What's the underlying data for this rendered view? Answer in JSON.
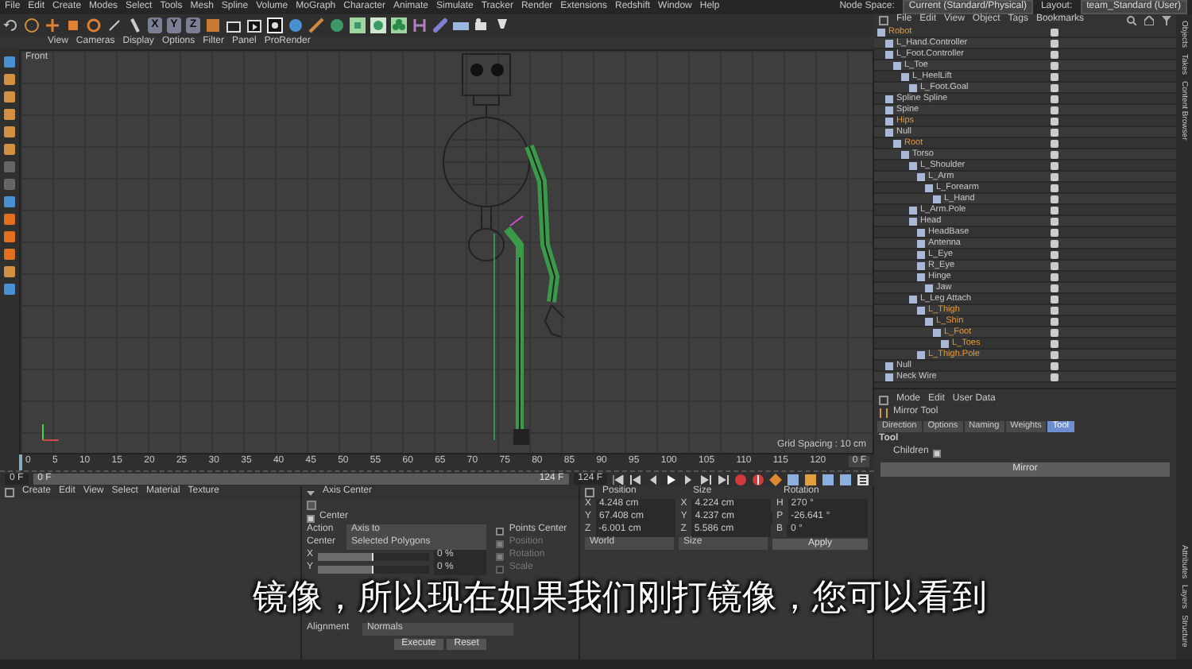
{
  "menu": [
    "File",
    "Edit",
    "Create",
    "Modes",
    "Select",
    "Tools",
    "Mesh",
    "Spline",
    "Volume",
    "MoGraph",
    "Character",
    "Animate",
    "Simulate",
    "Tracker",
    "Render",
    "Extensions",
    "Redshift",
    "Window",
    "Help"
  ],
  "node_space": {
    "label": "Node Space:",
    "value": "Current (Standard/Physical)"
  },
  "layout": {
    "label": "Layout:",
    "value": "team_Standard (User)"
  },
  "axis_buttons": [
    "X",
    "Y",
    "Z"
  ],
  "viewport": {
    "menu": [
      "View",
      "Cameras",
      "Display",
      "Options",
      "Filter",
      "Panel",
      "ProRender"
    ],
    "view_name": "Front",
    "grid_spacing": "Grid Spacing : 10 cm"
  },
  "timeline": {
    "ticks": [
      "0",
      "5",
      "10",
      "15",
      "20",
      "25",
      "30",
      "35",
      "40",
      "45",
      "50",
      "55",
      "60",
      "65",
      "70",
      "75",
      "80",
      "85",
      "90",
      "95",
      "100",
      "105",
      "110",
      "115",
      "120"
    ],
    "current_frame": "0 F",
    "start_field": "0 F",
    "range_start": "0 F",
    "range_end": "124 F",
    "end_field": "124 F"
  },
  "object_manager": {
    "menu": [
      "File",
      "Edit",
      "View",
      "Object",
      "Tags",
      "Bookmarks"
    ],
    "objects": [
      {
        "name": "Robot",
        "selected": true,
        "children": [
          {
            "name": "L_Hand.Controller",
            "selected": false
          },
          {
            "name": "L_Foot.Controller",
            "selected": false,
            "children": [
              {
                "name": "L_Toe",
                "selected": false,
                "children": [
                  {
                    "name": "L_HeelLift",
                    "selected": false,
                    "children": [
                      {
                        "name": "L_Foot.Goal",
                        "selected": false
                      }
                    ]
                  }
                ]
              }
            ]
          },
          {
            "name": "Spline Spline",
            "selected": false
          },
          {
            "name": "Spine",
            "selected": false
          },
          {
            "name": "Hips",
            "selected": true
          },
          {
            "name": "Null",
            "selected": false,
            "children": [
              {
                "name": "Root",
                "selected": true,
                "children": [
                  {
                    "name": "Torso",
                    "selected": false,
                    "children": [
                      {
                        "name": "L_Shoulder",
                        "selected": false,
                        "children": [
                          {
                            "name": "L_Arm",
                            "selected": false,
                            "children": [
                              {
                                "name": "L_Forearm",
                                "selected": false,
                                "children": [
                                  {
                                    "name": "L_Hand",
                                    "selected": false
                                  }
                                ]
                              }
                            ]
                          }
                        ]
                      },
                      {
                        "name": "L_Arm.Pole",
                        "selected": false
                      },
                      {
                        "name": "Head",
                        "selected": false,
                        "children": [
                          {
                            "name": "HeadBase",
                            "selected": false
                          },
                          {
                            "name": "Antenna",
                            "selected": false
                          },
                          {
                            "name": "L_Eye",
                            "selected": false
                          },
                          {
                            "name": "R_Eye",
                            "selected": false
                          },
                          {
                            "name": "Hinge",
                            "selected": false,
                            "children": [
                              {
                                "name": "Jaw",
                                "selected": false
                              }
                            ]
                          }
                        ]
                      },
                      {
                        "name": "L_Leg Attach",
                        "selected": false,
                        "children": [
                          {
                            "name": "L_Thigh",
                            "selected": true,
                            "children": [
                              {
                                "name": "L_Shin",
                                "selected": true,
                                "children": [
                                  {
                                    "name": "L_Foot",
                                    "selected": true,
                                    "children": [
                                      {
                                        "name": "L_Toes",
                                        "selected": true
                                      }
                                    ]
                                  }
                                ]
                              }
                            ]
                          },
                          {
                            "name": "L_Thigh.Pole",
                            "selected": true
                          }
                        ]
                      }
                    ]
                  }
                ]
              }
            ]
          },
          {
            "name": "Null",
            "selected": false
          },
          {
            "name": "Neck Wire",
            "selected": false
          }
        ]
      }
    ]
  },
  "side_tabs_top": [
    "Objects",
    "Takes",
    "Content Browser"
  ],
  "side_tabs_bottom": [
    "Attributes",
    "Layers",
    "Structure"
  ],
  "attributes": {
    "menu": [
      "Mode",
      "Edit",
      "User Data"
    ],
    "tool_name": "Mirror Tool",
    "tabs": [
      {
        "label": "Direction",
        "selected": false
      },
      {
        "label": "Options",
        "selected": false
      },
      {
        "label": "Naming",
        "selected": false
      },
      {
        "label": "Weights",
        "selected": false
      },
      {
        "label": "Tool",
        "selected": true
      }
    ],
    "section": "Tool",
    "children": {
      "label": "Children",
      "checked": true
    },
    "button": "Mirror"
  },
  "material_manager": {
    "menu": [
      "Create",
      "Edit",
      "View",
      "Select",
      "Material",
      "Texture"
    ]
  },
  "axis_center": {
    "title": "Axis Center",
    "center": {
      "label": "Center",
      "checked": true
    },
    "fields": [
      {
        "label": "Action",
        "value": "Axis to"
      },
      {
        "label": "Center",
        "value": "Selected Polygons"
      }
    ],
    "sliders": [
      {
        "label": "X",
        "level": 0.5,
        "reading": "0 %"
      },
      {
        "label": "Y",
        "level": 0.5,
        "reading": "0 %"
      }
    ],
    "options": [
      {
        "label": "Points Center",
        "checked": false,
        "disabled": false
      },
      {
        "label": "Position",
        "checked": true,
        "disabled": true
      },
      {
        "label": "Rotation",
        "checked": true,
        "disabled": true
      },
      {
        "label": "Scale",
        "checked": false,
        "disabled": true
      }
    ],
    "alignment": {
      "label": "Alignment",
      "value": "Normals"
    },
    "buttons": [
      "Execute",
      "Reset"
    ]
  },
  "coordinates": {
    "headers": [
      "Position",
      "Size",
      "Rotation"
    ],
    "rows": [
      {
        "pos_label": "X",
        "pos": "4.248 cm",
        "size_label": "X",
        "size": "4.224 cm",
        "rot_label": "H",
        "rot": "270 °"
      },
      {
        "pos_label": "Y",
        "pos": "67.408 cm",
        "size_label": "Y",
        "size": "4.237 cm",
        "rot_label": "P",
        "rot": "-26.641 °"
      },
      {
        "pos_label": "Z",
        "pos": "-6.001 cm",
        "size_label": "Z",
        "size": "5.586 cm",
        "rot_label": "B",
        "rot": "0 °"
      }
    ],
    "space": "World",
    "size_mode": "Size",
    "apply": "Apply"
  },
  "subtitle": "镜像，所以现在如果我们刚打镜像，您可以看到"
}
